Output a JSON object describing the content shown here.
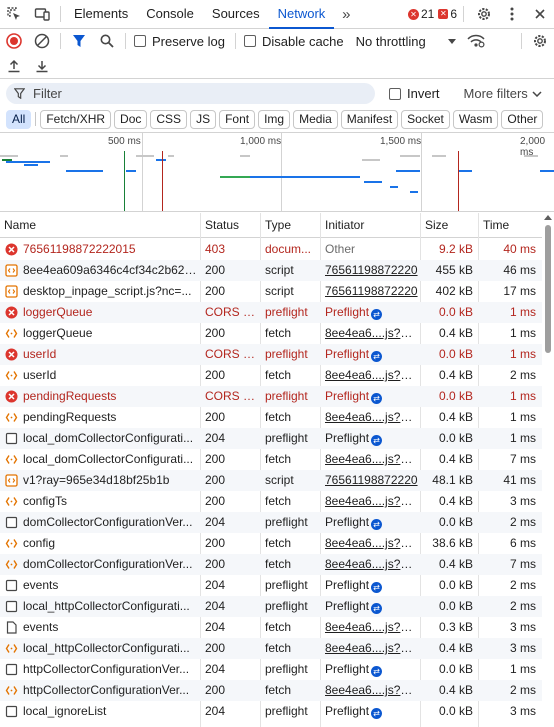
{
  "tabs": {
    "items": [
      "Elements",
      "Console",
      "Sources",
      "Network"
    ],
    "active": "Network",
    "more": "»",
    "errors": "21",
    "warnings": "6"
  },
  "toolbar": {
    "preserve_log": "Preserve log",
    "disable_cache": "Disable cache",
    "throttling": "No throttling"
  },
  "filter": {
    "placeholder": "Filter",
    "invert": "Invert",
    "more_filters": "More filters"
  },
  "chips": [
    "All",
    "Fetch/XHR",
    "Doc",
    "CSS",
    "JS",
    "Font",
    "Img",
    "Media",
    "Manifest",
    "Socket",
    "Wasm",
    "Other"
  ],
  "overview": {
    "ticks": [
      "500 ms",
      "1,000 ms",
      "1,500 ms",
      "2,000 ms"
    ]
  },
  "table": {
    "headers": [
      "Name",
      "Status",
      "Type",
      "Initiator",
      "Size",
      "Time"
    ],
    "rows": [
      {
        "name": "76561198872222015",
        "status": "403",
        "type": "docum...",
        "initiator": "Other",
        "size": "9.2 kB",
        "time": "40 ms",
        "error": true,
        "icon": "error-icon",
        "init_style": "other"
      },
      {
        "name": "8ee4ea609a6346c4cf34c2b621...",
        "status": "200",
        "type": "script",
        "initiator": "76561198872220",
        "size": "455 kB",
        "time": "46 ms",
        "error": false,
        "icon": "script-icon",
        "init_style": "link"
      },
      {
        "name": "desktop_inpage_script.js?nc=...",
        "status": "200",
        "type": "script",
        "initiator": "76561198872220",
        "size": "402 kB",
        "time": "17 ms",
        "error": false,
        "icon": "script-icon",
        "init_style": "link"
      },
      {
        "name": "loggerQueue",
        "status": "CORS e...",
        "type": "preflight",
        "initiator": "Preflight",
        "size": "0.0 kB",
        "time": "1 ms",
        "error": true,
        "icon": "error-icon",
        "init_style": "preflight"
      },
      {
        "name": "loggerQueue",
        "status": "200",
        "type": "fetch",
        "initiator": "8ee4ea6....js?nc=M",
        "size": "0.4 kB",
        "time": "1 ms",
        "error": false,
        "icon": "fetch-icon",
        "init_style": "link"
      },
      {
        "name": "userId",
        "status": "CORS e...",
        "type": "preflight",
        "initiator": "Preflight",
        "size": "0.0 kB",
        "time": "1 ms",
        "error": true,
        "icon": "error-icon",
        "init_style": "preflight"
      },
      {
        "name": "userId",
        "status": "200",
        "type": "fetch",
        "initiator": "8ee4ea6....js?nc=M",
        "size": "0.4 kB",
        "time": "2 ms",
        "error": false,
        "icon": "fetch-icon",
        "init_style": "link"
      },
      {
        "name": "pendingRequests",
        "status": "CORS e...",
        "type": "preflight",
        "initiator": "Preflight",
        "size": "0.0 kB",
        "time": "1 ms",
        "error": true,
        "icon": "error-icon",
        "init_style": "preflight"
      },
      {
        "name": "pendingRequests",
        "status": "200",
        "type": "fetch",
        "initiator": "8ee4ea6....js?nc=M",
        "size": "0.4 kB",
        "time": "1 ms",
        "error": false,
        "icon": "fetch-icon",
        "init_style": "link"
      },
      {
        "name": "local_domCollectorConfigurati...",
        "status": "204",
        "type": "preflight",
        "initiator": "Preflight",
        "size": "0.0 kB",
        "time": "1 ms",
        "error": false,
        "icon": "doc-icon",
        "init_style": "preflight"
      },
      {
        "name": "local_domCollectorConfigurati...",
        "status": "200",
        "type": "fetch",
        "initiator": "8ee4ea6....js?nc=M",
        "size": "0.4 kB",
        "time": "7 ms",
        "error": false,
        "icon": "fetch-icon",
        "init_style": "link"
      },
      {
        "name": "v1?ray=965e34d18bf25b1b",
        "status": "200",
        "type": "script",
        "initiator": "76561198872220",
        "size": "48.1 kB",
        "time": "41 ms",
        "error": false,
        "icon": "script-icon",
        "init_style": "link"
      },
      {
        "name": "configTs",
        "status": "200",
        "type": "fetch",
        "initiator": "8ee4ea6....js?nc=M",
        "size": "0.4 kB",
        "time": "3 ms",
        "error": false,
        "icon": "fetch-icon",
        "init_style": "link"
      },
      {
        "name": "domCollectorConfigurationVer...",
        "status": "204",
        "type": "preflight",
        "initiator": "Preflight",
        "size": "0.0 kB",
        "time": "2 ms",
        "error": false,
        "icon": "doc-icon",
        "init_style": "preflight"
      },
      {
        "name": "config",
        "status": "200",
        "type": "fetch",
        "initiator": "8ee4ea6....js?nc=M",
        "size": "38.6 kB",
        "time": "6 ms",
        "error": false,
        "icon": "fetch-icon",
        "init_style": "link"
      },
      {
        "name": "domCollectorConfigurationVer...",
        "status": "200",
        "type": "fetch",
        "initiator": "8ee4ea6....js?nc=M",
        "size": "0.4 kB",
        "time": "7 ms",
        "error": false,
        "icon": "fetch-icon",
        "init_style": "link"
      },
      {
        "name": "events",
        "status": "204",
        "type": "preflight",
        "initiator": "Preflight",
        "size": "0.0 kB",
        "time": "2 ms",
        "error": false,
        "icon": "doc-icon",
        "init_style": "preflight"
      },
      {
        "name": "local_httpCollectorConfigurati...",
        "status": "204",
        "type": "preflight",
        "initiator": "Preflight",
        "size": "0.0 kB",
        "time": "2 ms",
        "error": false,
        "icon": "doc-icon",
        "init_style": "preflight"
      },
      {
        "name": "events",
        "status": "204",
        "type": "fetch",
        "initiator": "8ee4ea6....js?nc=M",
        "size": "0.3 kB",
        "time": "3 ms",
        "error": false,
        "icon": "file-icon",
        "init_style": "link"
      },
      {
        "name": "local_httpCollectorConfigurati...",
        "status": "200",
        "type": "fetch",
        "initiator": "8ee4ea6....js?nc=M",
        "size": "0.4 kB",
        "time": "3 ms",
        "error": false,
        "icon": "fetch-icon",
        "init_style": "link"
      },
      {
        "name": "httpCollectorConfigurationVer...",
        "status": "204",
        "type": "preflight",
        "initiator": "Preflight",
        "size": "0.0 kB",
        "time": "1 ms",
        "error": false,
        "icon": "doc-icon",
        "init_style": "preflight"
      },
      {
        "name": "httpCollectorConfigurationVer...",
        "status": "200",
        "type": "fetch",
        "initiator": "8ee4ea6....js?nc=M",
        "size": "0.4 kB",
        "time": "2 ms",
        "error": false,
        "icon": "fetch-icon",
        "init_style": "link"
      },
      {
        "name": "local_ignoreList",
        "status": "204",
        "type": "preflight",
        "initiator": "Preflight",
        "size": "0.0 kB",
        "time": "3 ms",
        "error": false,
        "icon": "doc-icon",
        "init_style": "preflight"
      }
    ]
  },
  "colors": {
    "accent": "#0b57d0",
    "error": "#b3261e",
    "record": "#dc362e"
  }
}
